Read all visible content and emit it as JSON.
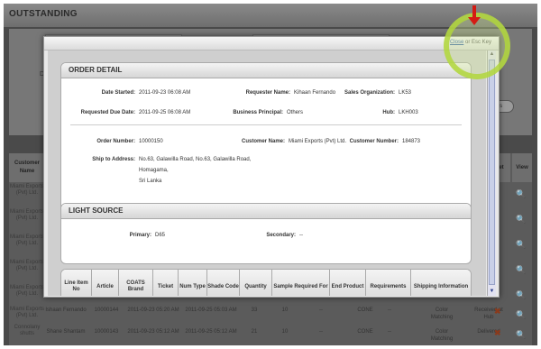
{
  "background": {
    "title": "OUTSTANDING",
    "filter_label": "D",
    "action_pill": "ers",
    "columns": {
      "customer_name": "Customer Name",
      "set": "et",
      "view": "View"
    },
    "customers": [
      "Miami Exports (Pvt) Ltd.",
      "Miami Exports (Pvt) Ltd.",
      "Miami Exports (Pvt) Ltd.",
      "Miami Exports (Pvt) Ltd.",
      "Miami Exports (Pvt) Ltd.",
      "Miami Exports (Pvt) Ltd.",
      "Connolany shutts",
      "Connolany shutts"
    ],
    "rows": [
      {
        "requester": "Ishaan Fernando",
        "order": "10000144",
        "date_started": "2011-09-23 05:20 AM",
        "due_date": "2011-09-25 05:03 AM",
        "qty": "33",
        "val1": "10",
        "val2": "--",
        "product": "CONE",
        "req": "--",
        "shipping": "Color Matching",
        "status": "Received at Hub"
      },
      {
        "requester": "Shane Shantam",
        "order": "10000143",
        "date_started": "2011-09-23 05:12 AM",
        "due_date": "2011-09-25 05:12 AM",
        "qty": "21",
        "val1": "10",
        "val2": "--",
        "product": "CONE",
        "req": "--",
        "shipping": "Color Matching",
        "status": "Delivered"
      }
    ]
  },
  "modal": {
    "close_text": "Close",
    "close_suffix": "or Esc Key",
    "order_detail": {
      "heading": "ORDER DETAIL",
      "date_started_label": "Date Started:",
      "date_started": "2011-09-23 06:08 AM",
      "requester_label": "Requester Name:",
      "requester": "Kihaan Fernando",
      "sales_org_label": "Sales Organization:",
      "sales_org": "LK53",
      "due_date_label": "Requested Due Date:",
      "due_date": "2011-09-25 06:08 AM",
      "principal_label": "Business Principal:",
      "principal": "Others",
      "hub_label": "Hub:",
      "hub": "LKH003",
      "order_number_label": "Order Number:",
      "order_number": "10000150",
      "customer_name_label": "Customer Name:",
      "customer_name": "Miami Exports (Pvt) Ltd.",
      "customer_number_label": "Customer Number:",
      "customer_number": "184873",
      "ship_to_label": "Ship to Address:",
      "ship_line1": "No.63, Galawilla Road, No.63, Galawilla Road,",
      "ship_line2": "Homagama,",
      "ship_line3": "Sri Lanka"
    },
    "light_source": {
      "heading": "LIGHT SOURCE",
      "primary_label": "Primary:",
      "primary": "D65",
      "secondary_label": "Secondary:",
      "secondary": "--"
    },
    "items_table": {
      "headers": [
        "Line Item No",
        "Article",
        "COATS Brand",
        "Ticket",
        "Num Type",
        "Shade Code",
        "Quantity",
        "Sample Required For",
        "End Product",
        "Requirements",
        "Shipping Information"
      ]
    }
  },
  "colors": {
    "highlight_ring": "#b0d63c",
    "arrow": "#d41c14",
    "link": "#3460a8"
  }
}
